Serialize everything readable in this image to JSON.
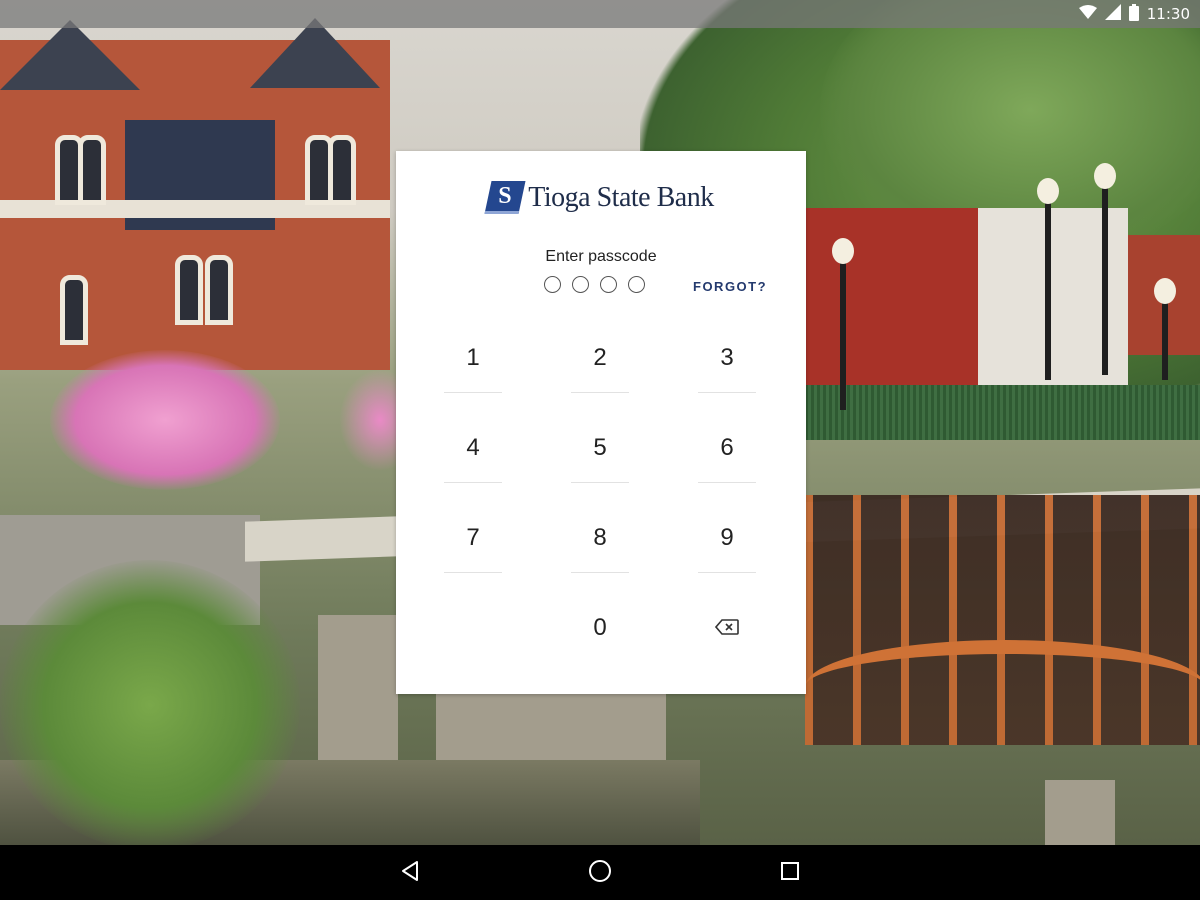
{
  "status_bar": {
    "time": "11:30",
    "icons": [
      "wifi-icon",
      "cell-signal-icon",
      "battery-icon"
    ]
  },
  "login": {
    "brand_name": "Tioga State Bank",
    "brand_mark": "S",
    "passcode_label": "Enter passcode",
    "passcode_length": 4,
    "forgot_label": "FORGOT?",
    "keys": {
      "k1": "1",
      "k2": "2",
      "k3": "3",
      "k4": "4",
      "k5": "5",
      "k6": "6",
      "k7": "7",
      "k8": "8",
      "k9": "9",
      "k0": "0"
    },
    "backspace_icon": "backspace-icon"
  },
  "nav_bar": {
    "icons": [
      "back-icon",
      "home-icon",
      "recents-icon"
    ]
  },
  "colors": {
    "brand_blue": "#24478f",
    "forgot_text": "#243a6e",
    "card_bg": "#ffffff"
  }
}
